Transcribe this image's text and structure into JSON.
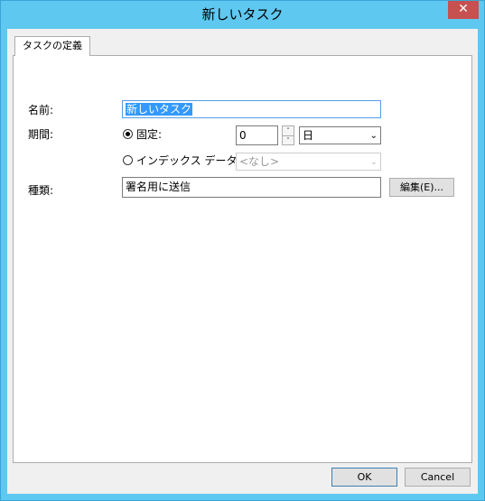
{
  "window": {
    "title": "新しいタスク",
    "close_label": "✕"
  },
  "tab": {
    "label": "タスクの定義"
  },
  "form": {
    "name_label": "名前:",
    "name_value": "新しいタスク",
    "period_label": "期間:",
    "fixed_label": "固定:",
    "fixed_value": "0",
    "unit_value": "日",
    "index_label": "インデックス データ:",
    "index_value": "<なし>",
    "type_label": "種類:",
    "type_value": "署名用に送信",
    "edit_button": "編集(E)..."
  },
  "buttons": {
    "ok": "OK",
    "cancel": "Cancel"
  },
  "icons": {
    "spin_up": "˄",
    "spin_down": "˅",
    "chevron": "⌄"
  }
}
